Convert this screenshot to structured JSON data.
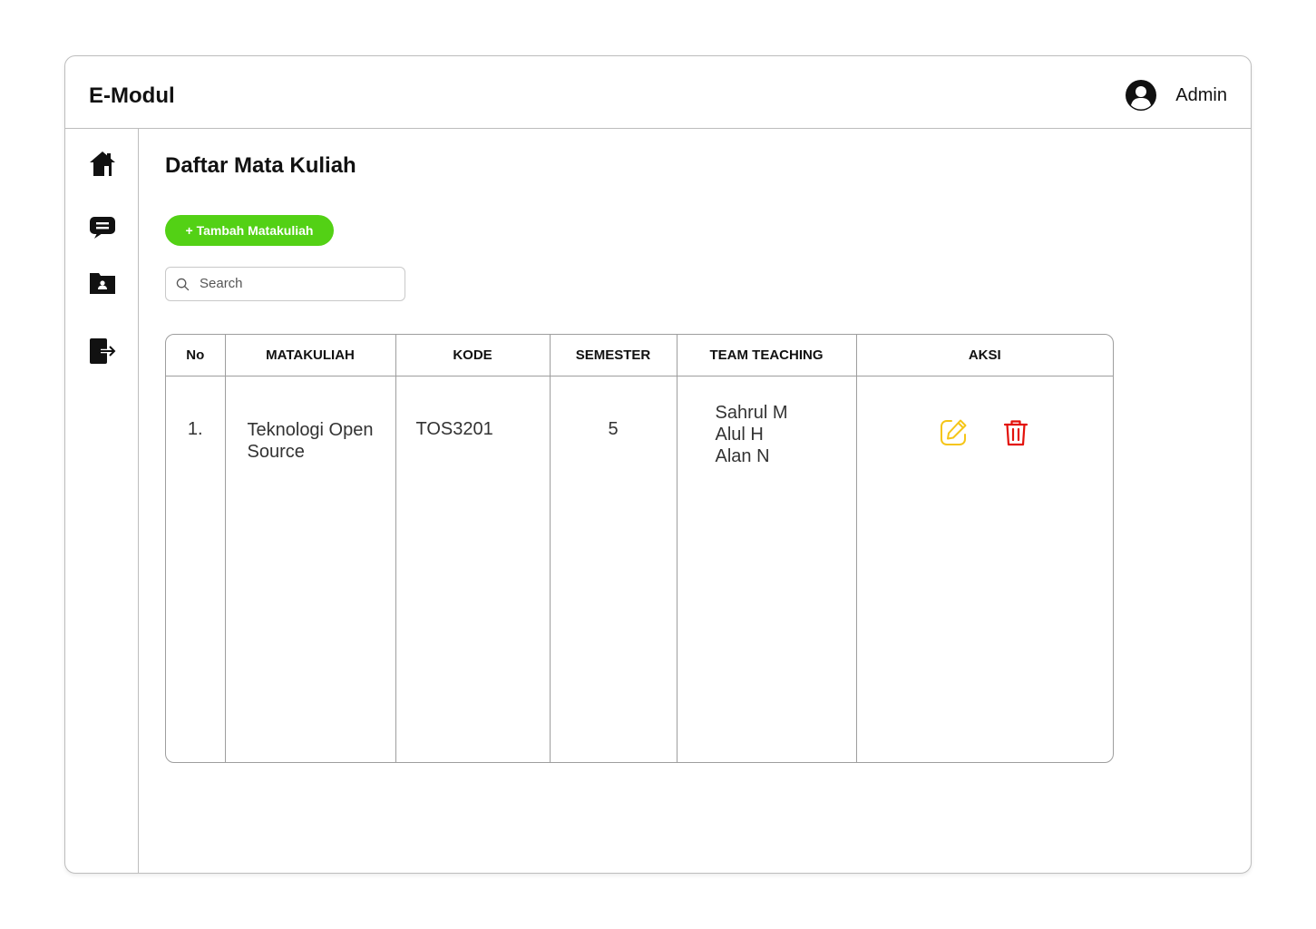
{
  "app": {
    "title": "E-Modul"
  },
  "user": {
    "name": "Admin",
    "avatar_icon": "user-circle-icon"
  },
  "sidebar": {
    "items": [
      {
        "name": "home",
        "icon": "home-icon"
      },
      {
        "name": "messages",
        "icon": "message-icon"
      },
      {
        "name": "user-folder",
        "icon": "folder-user-icon"
      },
      {
        "name": "logout",
        "icon": "logout-icon"
      }
    ]
  },
  "page": {
    "title": "Daftar Mata Kuliah",
    "add_button_label": "+ Tambah Matakuliah",
    "add_button_color": "#53d115"
  },
  "search": {
    "placeholder": "Search",
    "value": ""
  },
  "table": {
    "headers": [
      "No",
      "MATAKULIAH",
      "KODE",
      "SEMESTER",
      "TEAM TEACHING",
      "AKSI"
    ],
    "rows": [
      {
        "no": "1.",
        "matakuliah": "Teknologi Open Source",
        "kode": "TOS3201",
        "semester": "5",
        "team_teaching": [
          "Sahrul M",
          "Alul H",
          "Alan N"
        ],
        "actions": [
          {
            "name": "edit",
            "icon": "edit-icon",
            "color": "#f5c518"
          },
          {
            "name": "delete",
            "icon": "trash-icon",
            "color": "#e3120b"
          }
        ]
      }
    ]
  }
}
